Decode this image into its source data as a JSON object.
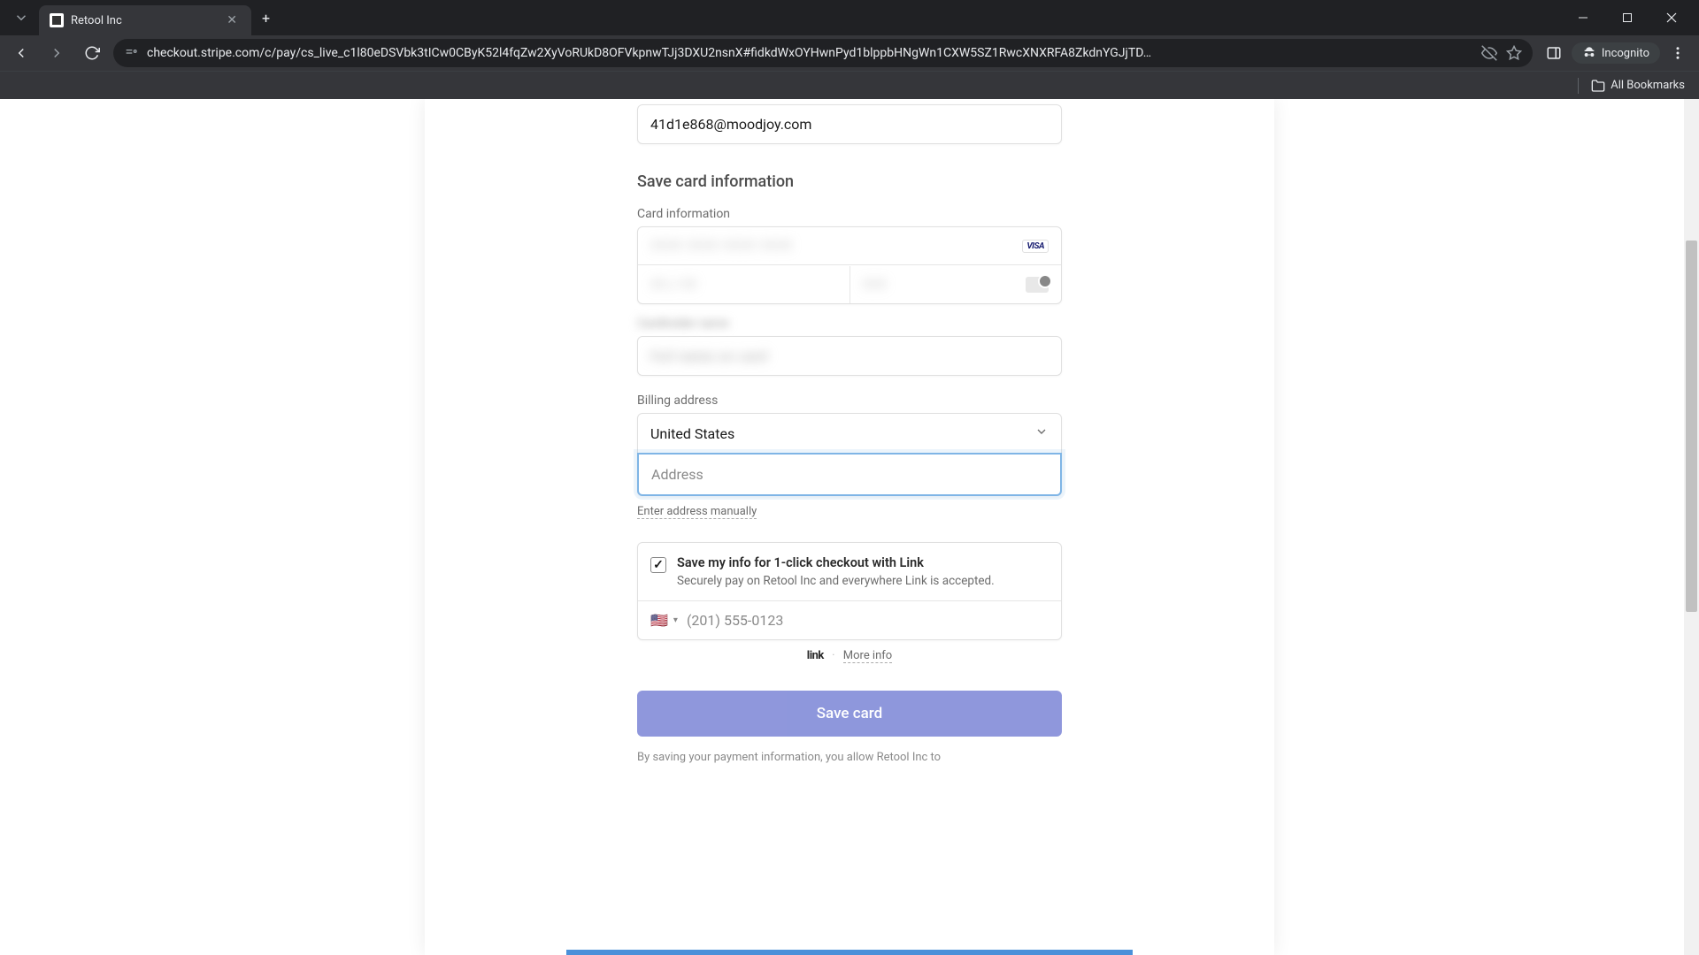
{
  "browser": {
    "tab_title": "Retool Inc",
    "url": "checkout.stripe.com/c/pay/cs_live_c1l80eDSVbk3tICw0CByK52l4fqZw2XyVoRUkD8OFVkpnwTJj3DXU2nsnX#fidkdWxOYHwnPyd1blppbHNgWn1CXW5SZ1RwcXNXRFA8ZkdnYGJjTD…",
    "incognito_label": "Incognito",
    "all_bookmarks": "All Bookmarks"
  },
  "checkout": {
    "email": "41d1e868@moodjoy.com",
    "section_title": "Save card information",
    "card_label": "Card information",
    "visa_label": "VISA",
    "billing_label": "Billing address",
    "country": "United States",
    "address_placeholder": "Address",
    "manual_link": "Enter address manually",
    "link_save_title": "Save my info for 1-click checkout with Link",
    "link_save_desc": "Securely pay on Retool Inc and everywhere Link is accepted.",
    "phone_flag": "🇺🇸",
    "phone_placeholder": "(201) 555-0123",
    "link_brand": "link",
    "more_info": "More info",
    "save_button": "Save card",
    "terms": "By saving your payment information, you allow Retool Inc to"
  }
}
